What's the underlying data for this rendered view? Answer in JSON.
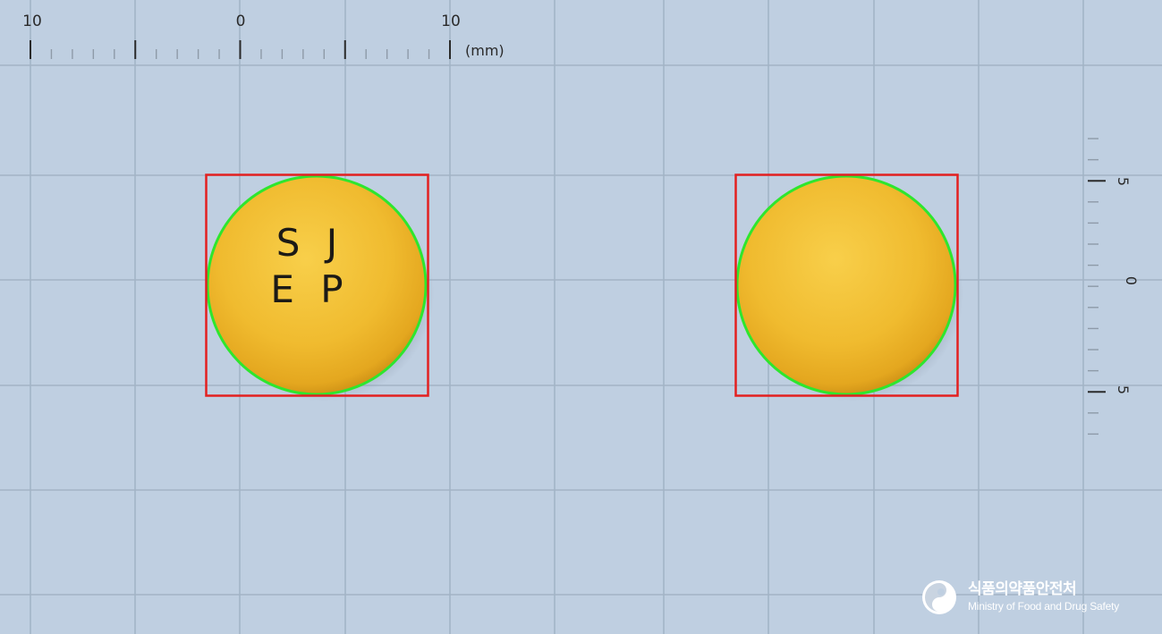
{
  "ruler_top": {
    "labels": [
      "10",
      "0",
      "10"
    ],
    "unit": "(mm)"
  },
  "ruler_right": {
    "labels": [
      "5",
      "0",
      "5"
    ]
  },
  "pills": [
    {
      "side": "front",
      "imprint_line1": "S J",
      "imprint_line2": "E P"
    },
    {
      "side": "back",
      "imprint_line1": "",
      "imprint_line2": ""
    }
  ],
  "colors": {
    "background": "#bfcfe1",
    "grid": "#a3b4c6",
    "pill": "#f2b92b",
    "bbox": "#e32020",
    "contour": "#2ee62e",
    "imprint": "#1c1a16"
  },
  "watermark": {
    "korean": "식품의약품안전처",
    "english": "Ministry of Food and Drug Safety"
  }
}
